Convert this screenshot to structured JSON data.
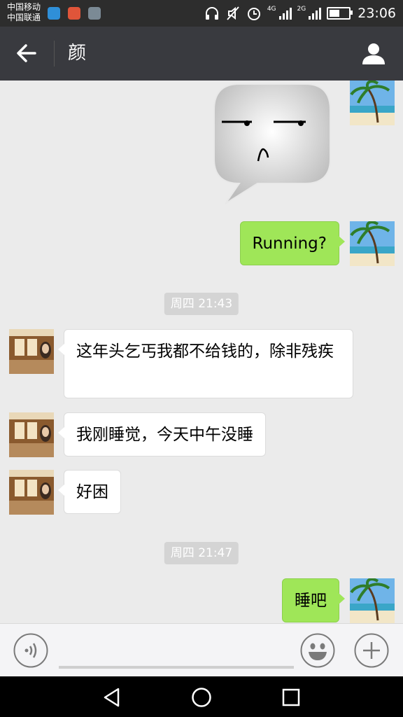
{
  "status_bar": {
    "carrier_1": "中国移动",
    "carrier_2": "中国联通",
    "network_1": "4G",
    "network_2": "2G",
    "time": "23:06",
    "icons": [
      "headphones-icon",
      "mute-icon",
      "alarm-icon",
      "signal-icon",
      "battery-charging-icon"
    ]
  },
  "header": {
    "title": "颜",
    "back_icon": "arrow-left-icon",
    "profile_icon": "person-icon"
  },
  "messages": [
    {
      "type": "sticker",
      "side": "right",
      "content": "neutral-face-sticker"
    },
    {
      "type": "text",
      "side": "right",
      "text": "Running?"
    },
    {
      "type": "time",
      "text": "周四 21:43"
    },
    {
      "type": "text",
      "side": "left",
      "text": "这年头乞丐我都不给钱的，除非残疾"
    },
    {
      "type": "text",
      "side": "left",
      "text": "我刚睡觉，今天中午没睡"
    },
    {
      "type": "text",
      "side": "left",
      "text": "好困"
    },
    {
      "type": "time",
      "text": "周四 21:47"
    },
    {
      "type": "text",
      "side": "right",
      "text": "睡吧"
    }
  ],
  "input_bar": {
    "voice_icon": "voice-icon",
    "emoji_icon": "emoji-icon",
    "plus_icon": "plus-icon",
    "text_value": ""
  },
  "nav_bar": {
    "icons": [
      "back-triangle-icon",
      "home-circle-icon",
      "recents-square-icon"
    ]
  },
  "colors": {
    "title_bar": "#393a3f",
    "status_bar": "#2d2d2d",
    "outgoing_bubble": "#9fe658",
    "incoming_bubble": "#ffffff",
    "background": "#ebebeb"
  }
}
